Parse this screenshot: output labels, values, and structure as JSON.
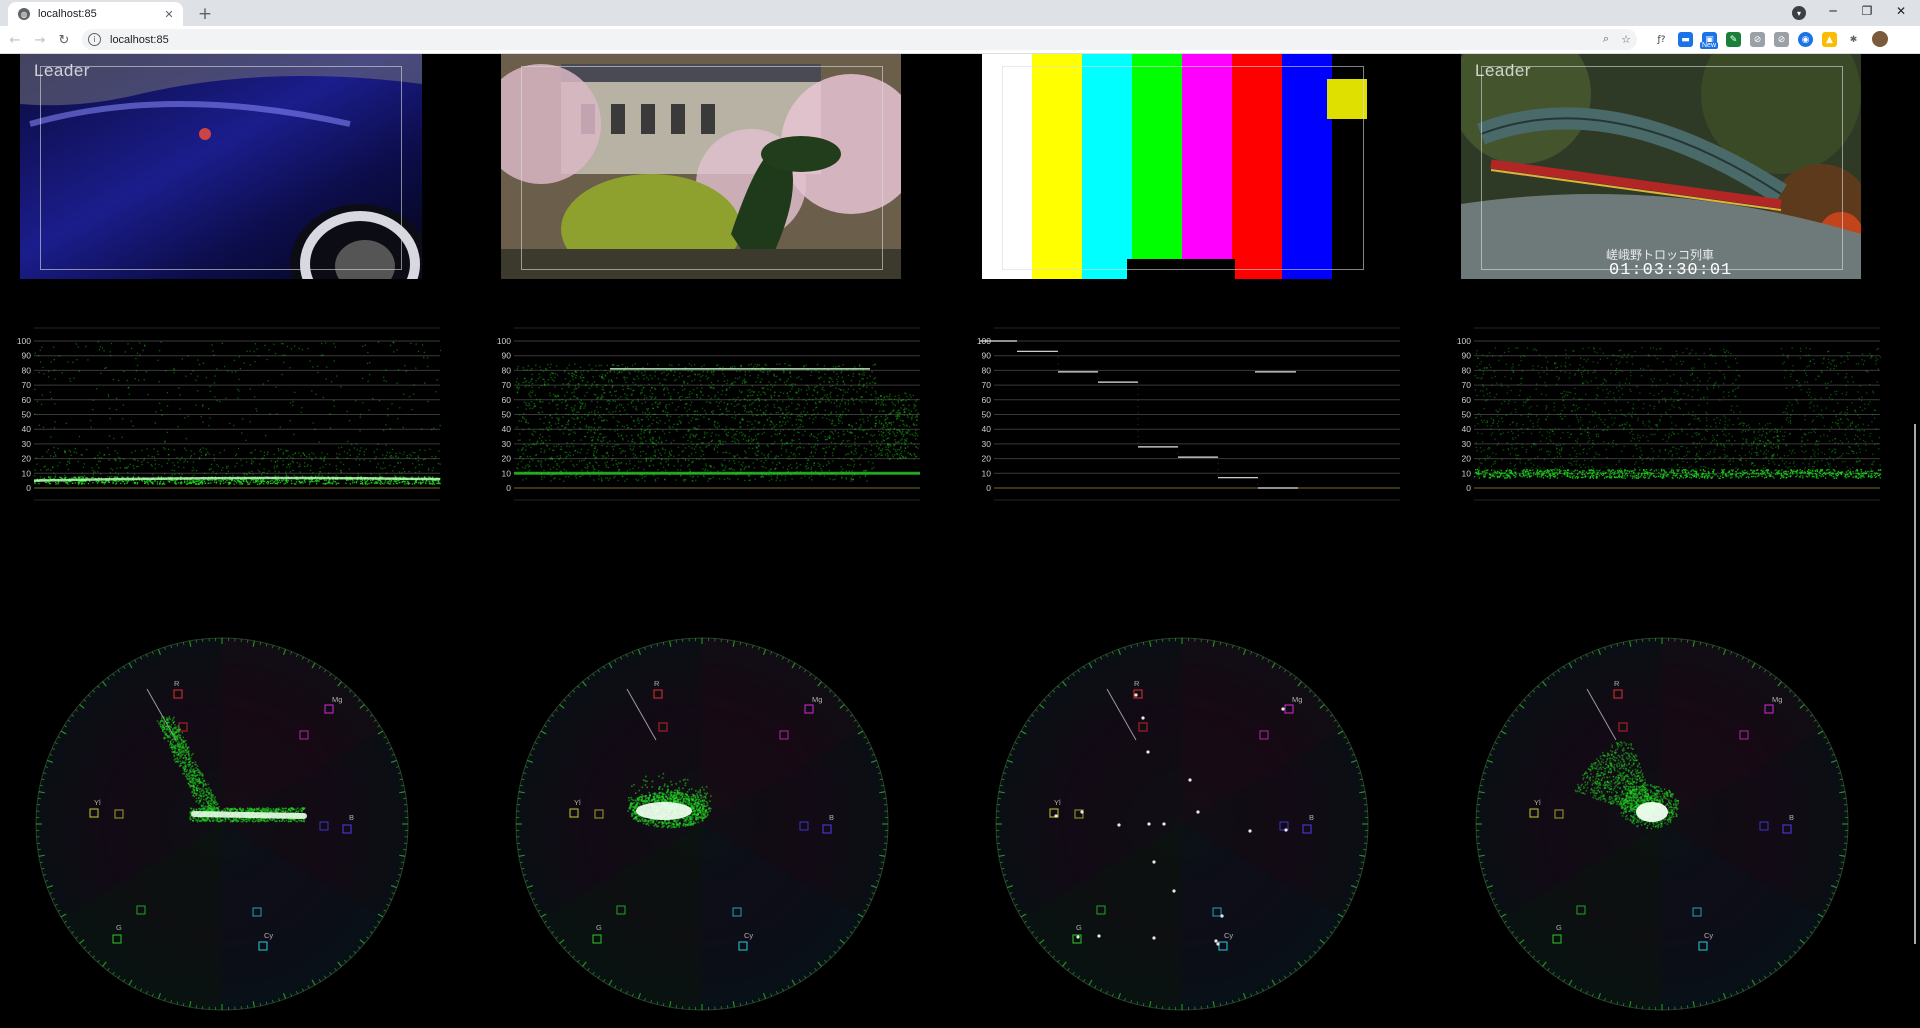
{
  "browser": {
    "tab_title": "localhost:85",
    "tab_close": "✕",
    "new_tab": "+",
    "url": "localhost:85",
    "back": "←",
    "forward": "→",
    "reload": "↻",
    "info": "i",
    "zoom_icon": "⌕",
    "star_icon": "☆",
    "minimize": "─",
    "restore": "❐",
    "close": "✕",
    "extensions": [
      "ƒ?",
      "▬",
      "▣",
      "✎",
      "⊘",
      "⊘",
      "◉",
      "▲",
      "✱"
    ],
    "new_badge": "New"
  },
  "columns": [
    {
      "id": "car",
      "logo": "Leader",
      "timecode": "",
      "caption": ""
    },
    {
      "id": "garden",
      "logo": "",
      "timecode": "",
      "caption": ""
    },
    {
      "id": "colorbars",
      "logo": "",
      "timecode": "",
      "caption": ""
    },
    {
      "id": "train",
      "logo": "Leader",
      "timecode": "01:03:30:01",
      "caption": "嵯峨野トロッコ列車"
    }
  ],
  "waveform_scale": [
    "100",
    "90",
    "80",
    "70",
    "60",
    "50",
    "40",
    "30",
    "20",
    "10",
    "0"
  ],
  "vector_targets": [
    "R",
    "Mg",
    "B",
    "Cy",
    "G",
    "Yl"
  ],
  "colors": {
    "trace": "#19d919",
    "grid": "#3a3a3a",
    "accent_green": "#22ff22"
  }
}
